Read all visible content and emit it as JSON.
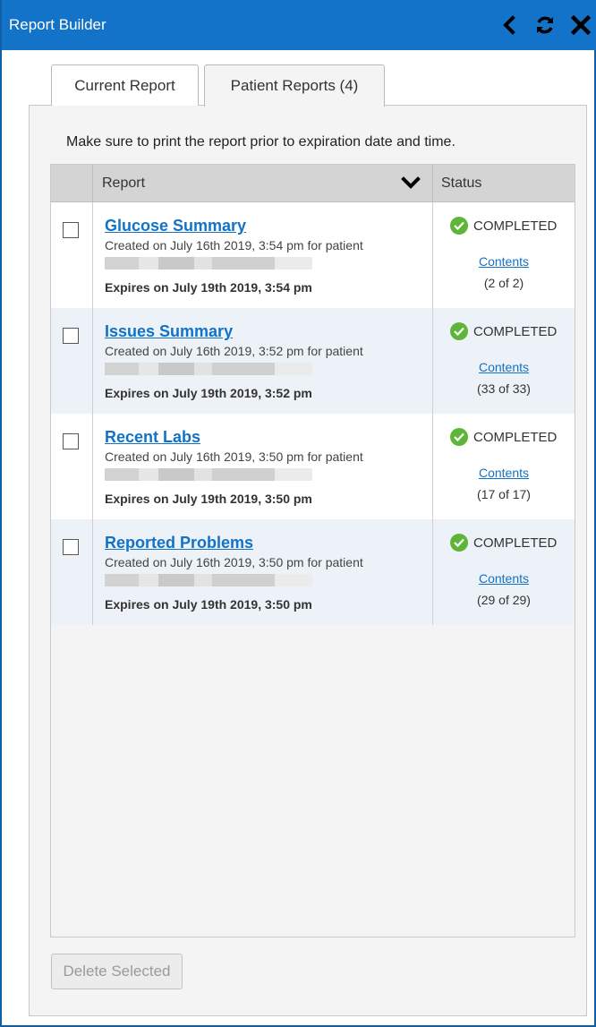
{
  "window": {
    "title": "Report Builder"
  },
  "tabs": [
    {
      "label": "Current Report"
    },
    {
      "label": "Patient Reports (4)"
    }
  ],
  "notice": "Make sure to print the report prior to expiration date and time.",
  "table": {
    "columns": {
      "report": "Report",
      "status": "Status"
    },
    "rows": [
      {
        "name": "Glucose Summary",
        "created": "Created on July 16th 2019, 3:54 pm for patient",
        "expires": "Expires on July 19th 2019, 3:54 pm",
        "status": "COMPLETED",
        "contents": "Contents",
        "count": "(2 of 2)"
      },
      {
        "name": "Issues Summary",
        "created": "Created on July 16th 2019, 3:52 pm for patient",
        "expires": "Expires on July 19th 2019, 3:52 pm",
        "status": "COMPLETED",
        "contents": "Contents",
        "count": "(33 of 33)"
      },
      {
        "name": "Recent Labs",
        "created": "Created on July 16th 2019, 3:50 pm for patient",
        "expires": "Expires on July 19th 2019, 3:50 pm",
        "status": "COMPLETED",
        "contents": "Contents",
        "count": "(17 of 17)"
      },
      {
        "name": "Reported Problems",
        "created": "Created on July 16th 2019, 3:50 pm for patient",
        "expires": "Expires on July 19th 2019, 3:50 pm",
        "status": "COMPLETED",
        "contents": "Contents",
        "count": "(29 of 29)"
      }
    ]
  },
  "footer": {
    "delete_label": "Delete Selected"
  },
  "icons": {
    "back": "chevron-left-icon",
    "refresh": "refresh-icon",
    "close": "close-icon",
    "sort": "chevron-down-icon",
    "status": "check-circle-icon"
  },
  "colors": {
    "titlebar": "#1273c9",
    "link": "#1272c6",
    "completed": "#5fb43a"
  }
}
